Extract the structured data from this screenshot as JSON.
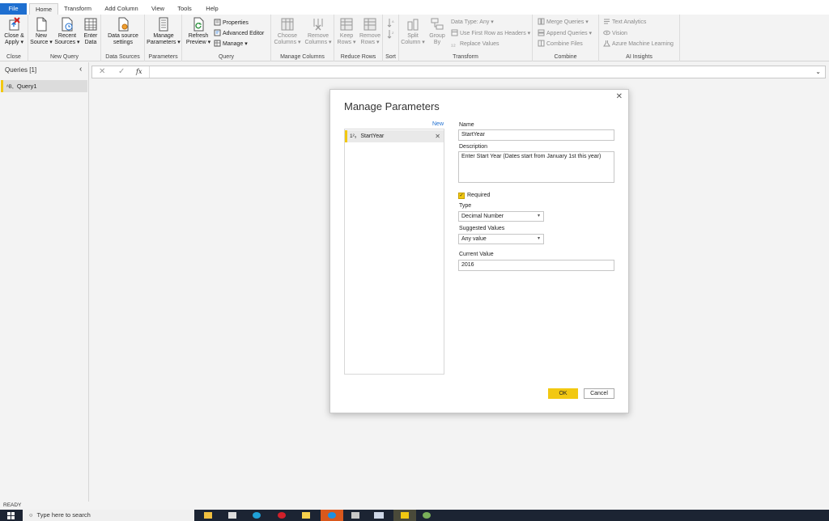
{
  "tabs": [
    "File",
    "Home",
    "Transform",
    "Add Column",
    "View",
    "Tools",
    "Help"
  ],
  "ribbon": {
    "close_apply": "Close &\nApply ▾",
    "new_source": "New\nSource ▾",
    "recent_sources": "Recent\nSources ▾",
    "enter_data": "Enter\nData",
    "data_source_settings": "Data source\nsettings",
    "manage_parameters": "Manage\nParameters ▾",
    "refresh_preview": "Refresh\nPreview ▾",
    "properties": "Properties",
    "advanced_editor": "Advanced Editor",
    "manage": "Manage ▾",
    "choose_columns": "Choose\nColumns ▾",
    "remove_columns": "Remove\nColumns ▾",
    "keep_rows": "Keep\nRows ▾",
    "remove_rows": "Remove\nRows ▾",
    "split_column": "Split\nColumn ▾",
    "group_by": "Group\nBy",
    "data_type": "Data Type: Any ▾",
    "use_first_row": "Use First Row as Headers ▾",
    "replace_values": "Replace Values",
    "merge_queries": "Merge Queries ▾",
    "append_queries": "Append Queries ▾",
    "combine_files": "Combine Files",
    "text_analytics": "Text Analytics",
    "vision": "Vision",
    "azure_ml": "Azure Machine Learning",
    "groups": {
      "close": "Close",
      "new_query": "New Query",
      "data_sources": "Data Sources",
      "parameters": "Parameters",
      "query": "Query",
      "manage_columns": "Manage Columns",
      "reduce_rows": "Reduce Rows",
      "sort": "Sort",
      "transform": "Transform",
      "combine": "Combine",
      "ai_insights": "AI Insights"
    }
  },
  "queries": {
    "header": "Queries [1]",
    "items": [
      {
        "label": "Query1",
        "type_glyph": "ᴬB꜀"
      }
    ]
  },
  "formula": {
    "fx": "fx"
  },
  "dialog": {
    "title": "Manage Parameters",
    "new_link": "New",
    "parameters": [
      {
        "type_glyph": "1²₃",
        "name": "StartYear"
      }
    ],
    "name_label": "Name",
    "name_value": "StartYear",
    "description_label": "Description",
    "description_value": "Enter Start Year (Dates start from January 1st this year)",
    "required_label": "Required",
    "required_checked": true,
    "type_label": "Type",
    "type_value": "Decimal Number",
    "suggested_label": "Suggested Values",
    "suggested_value": "Any value",
    "current_label": "Current Value",
    "current_value": "2016",
    "ok": "OK",
    "cancel": "Cancel"
  },
  "status": "READY",
  "taskbar": {
    "search_placeholder": "Type here to search"
  },
  "colors": {
    "accent": "#1e6fd0",
    "ok_button": "#f2c811",
    "arrow": "#e11d1d"
  }
}
